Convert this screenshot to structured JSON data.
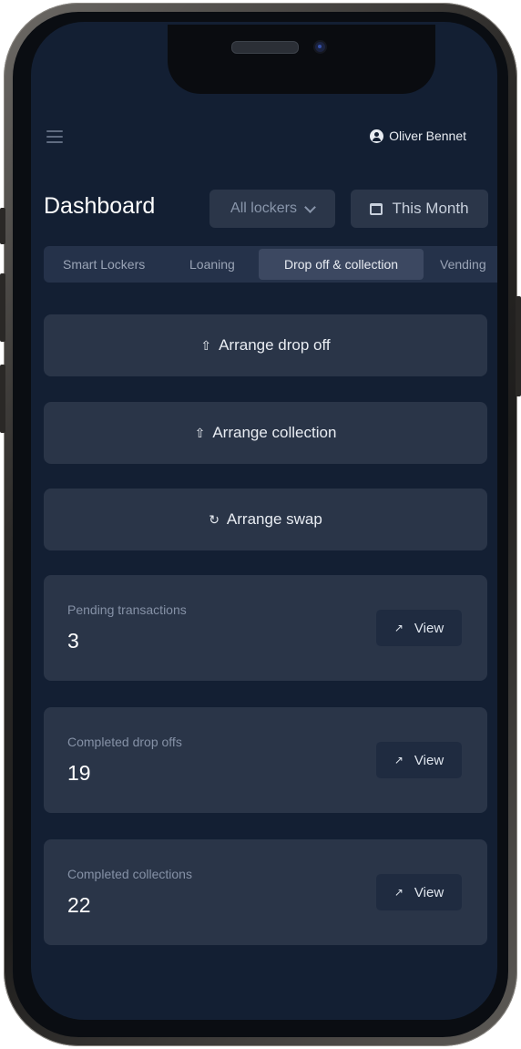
{
  "header": {
    "user_name": "Oliver Bennet"
  },
  "page": {
    "title": "Dashboard"
  },
  "filters": {
    "locker_select": "All lockers",
    "date_range": "This Month"
  },
  "tabs": [
    {
      "label": "Smart Lockers",
      "active": false
    },
    {
      "label": "Loaning",
      "active": false
    },
    {
      "label": "Drop off & collection",
      "active": true
    },
    {
      "label": "Vending",
      "active": false
    }
  ],
  "actions": {
    "drop_off": "Arrange drop off",
    "collection": "Arrange collection",
    "swap": "Arrange swap"
  },
  "cards": [
    {
      "label": "Pending transactions",
      "value": "3",
      "button": "View"
    },
    {
      "label": "Completed drop offs",
      "value": "19",
      "button": "View"
    },
    {
      "label": "Completed collections",
      "value": "22",
      "button": "View"
    }
  ],
  "colors": {
    "background": "#131f33",
    "surface": "#2a3548",
    "tab_active": "#3c4861"
  }
}
